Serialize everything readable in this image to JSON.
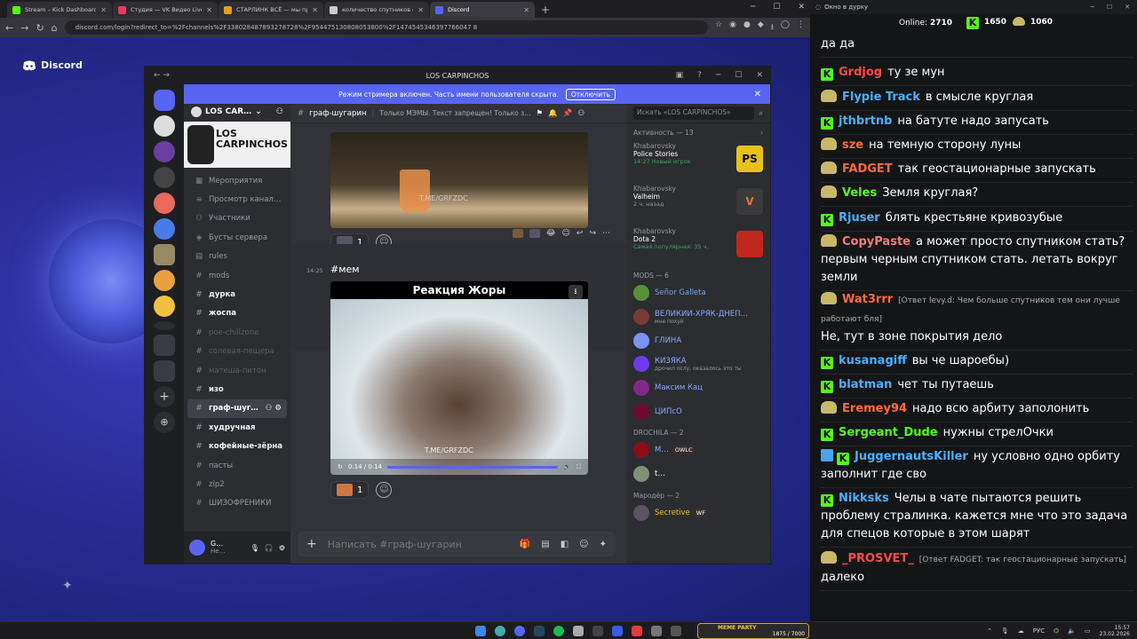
{
  "browser": {
    "tabs": [
      {
        "title": "Stream – Kick Dashboard",
        "color": "#53fc18"
      },
      {
        "title": "Студия — VK Видео Live",
        "color": "#e63a5a"
      },
      {
        "title": "СТАРЛИНК ВСЁ — мы проигр…",
        "color": "#e0a020"
      },
      {
        "title": "количество спутников старл…",
        "color": "#cccccc"
      },
      {
        "title": "Discord",
        "color": "#5865f2"
      }
    ],
    "url": "discord.com/login?redirect_to=%2Fchannels%2F338028487893278728%2F954475130808053800%2F1474545346397766047 8"
  },
  "page": {
    "logo": "Discord"
  },
  "discord": {
    "window_title": "LOS CARPINCHOS",
    "banner_text": "Режим стримера включен. Часть имени пользователя скрыта.",
    "banner_button": "Отключить",
    "server_name": "LOS CAR…",
    "server_banner": "LOS CARPINCHOS",
    "channels": [
      {
        "name": "Мероприятия",
        "icon": "calendar-icon",
        "style": "normal"
      },
      {
        "name": "Просмотр канал…",
        "icon": "browse-icon",
        "style": "normal"
      },
      {
        "name": "Участники",
        "icon": "members-icon",
        "style": "normal"
      },
      {
        "name": "Бусты сервера",
        "icon": "boost-icon",
        "style": "normal"
      },
      {
        "name": "rules",
        "icon": "rules-icon",
        "style": "normal"
      },
      {
        "name": "mods",
        "icon": "#",
        "style": "normal"
      },
      {
        "name": "дурка",
        "icon": "#",
        "style": "bold"
      },
      {
        "name": "жоспа",
        "icon": "#",
        "style": "bold"
      },
      {
        "name": "poe-chillzone",
        "icon": "#",
        "style": "muted"
      },
      {
        "name": "солевая-пещера",
        "icon": "#",
        "style": "muted"
      },
      {
        "name": "матеша-питон",
        "icon": "#",
        "style": "muted"
      },
      {
        "name": "изо",
        "icon": "#",
        "style": "bold"
      },
      {
        "name": "граф-шуг…",
        "icon": "#",
        "style": "selected"
      },
      {
        "name": "худручная",
        "icon": "#",
        "style": "bold"
      },
      {
        "name": "кофейные-зёрна",
        "icon": "#",
        "style": "bold"
      },
      {
        "name": "пасты",
        "icon": "#",
        "style": "normal"
      },
      {
        "name": "zip2",
        "icon": "#",
        "style": "normal"
      },
      {
        "name": "ШИЗОФРЕНИКИ",
        "icon": "#",
        "style": "normal"
      }
    ],
    "user": {
      "name": "G…",
      "status": "Не…"
    },
    "channel_name": "граф-шугарин",
    "channel_topic": "Только МЭМЫ. Текст запрещен! Только з…",
    "search_placeholder": "Искать «LOS CARPINCHOS»",
    "image1_watermark": "T.ME/GRFZDC",
    "reaction1_count": "1",
    "message_time": "14:25",
    "message_text": "#мем",
    "video_title": "Реакция Жоры",
    "video_watermark": "T.ME/GRFZDC",
    "video_time": "0:14 / 0:14",
    "video_progress": 1.0,
    "reaction2_count": "1",
    "composer_placeholder": "Написать #граф-шугарин",
    "activity_header": "Активность — 13",
    "activities": [
      {
        "user": "Khabarovsky",
        "game": "Police Stories",
        "time": "14:27",
        "extra": "Новый игрок",
        "color": "#e8c21a",
        "label": "PS"
      },
      {
        "user": "Khabarovsky",
        "game": "Valheim",
        "time": "2 ч. назад",
        "extra": "",
        "color": "#3a3a3a",
        "label": "V"
      },
      {
        "user": "Khabarovsky",
        "game": "Dota 2",
        "time": "Самая популярная: 35 ч.",
        "extra": "",
        "color": "#c0271e",
        "label": ""
      }
    ],
    "mods_header": "MODS — 6",
    "mods": [
      {
        "name": "Señor Galleta",
        "sub": "",
        "color": "#78a8e8"
      },
      {
        "name": "ВЕЛИКИЙ-ХРЯК-ДНЕП…",
        "sub": "мне похуй",
        "color": "#8ca8ff"
      },
      {
        "name": "ГЛИНА",
        "sub": "",
        "color": "#8ca8ff"
      },
      {
        "name": "КИЗЯКА",
        "sub": "дрочил ослу, оказалось это ты",
        "color": "#8ca8ff"
      },
      {
        "name": "Максим Кац",
        "sub": "",
        "color": "#8ca8ff"
      },
      {
        "name": "ЦИПсО",
        "sub": "",
        "color": "#8ca8ff"
      }
    ],
    "drochila_header": "DROCHILA — 2",
    "drochila": [
      {
        "name": "M…",
        "tag": "OWLC",
        "color": "#8ca8ff"
      },
      {
        "name": "t…",
        "tag": "",
        "color": "#ffffff"
      }
    ],
    "marauder_header": "Мародёр — 2",
    "marauders": [
      {
        "name": "Secretive",
        "tag": "WF",
        "color": "#e8c21a"
      }
    ]
  },
  "chat": {
    "window_title": "Окно в дурку",
    "online_label": "Online:",
    "online": "2710",
    "kick_count": "1650",
    "other_count": "1060",
    "messages": [
      {
        "user": "",
        "reply": "",
        "text": "да да",
        "badge": "none",
        "color": "#ffffff"
      },
      {
        "user": "Grdjog",
        "reply": "",
        "text": "ту зе мун",
        "badge": "kick",
        "color": "#ff4a4a"
      },
      {
        "user": "Flypie Track",
        "reply": "",
        "text": "в смысле круглая",
        "badge": "hat",
        "color": "#4ab0ff"
      },
      {
        "user": "jthbrtnb",
        "reply": "",
        "text": "на батуте надо запусать",
        "badge": "kick",
        "color": "#4ab0ff"
      },
      {
        "user": "sze",
        "reply": "",
        "text": "на темную сторону луны",
        "badge": "hat",
        "color": "#ff6a3a"
      },
      {
        "user": "FADGET",
        "reply": "",
        "text": "так геостационарные запускать",
        "badge": "hat",
        "color": "#ff6a3a"
      },
      {
        "user": "Veles",
        "reply": "",
        "text": "Земля круглая?",
        "badge": "hat",
        "color": "#53fc18"
      },
      {
        "user": "Rjuser",
        "reply": "",
        "text": "блять крестьяне кривозубые",
        "badge": "kick",
        "color": "#4ab0ff"
      },
      {
        "user": "CopyPaste",
        "reply": "",
        "text": "а может просто спутником стать? первым черным спутником стать. летать вокруг земли",
        "badge": "hat",
        "color": "#ff7a7a"
      },
      {
        "user": "Wat3rrr",
        "reply": "[Ответ levy.d: Чем больше спутников тем они лучше работают бля]",
        "text": "Не, тут в зоне покрытия дело",
        "badge": "hat",
        "color": "#ff6a3a"
      },
      {
        "user": "kusanagiff",
        "reply": "",
        "text": "вы че шароебы)",
        "badge": "kick",
        "color": "#4ab0ff"
      },
      {
        "user": "blatman",
        "reply": "",
        "text": "чет ты путаешь",
        "badge": "kick",
        "color": "#4ab0ff"
      },
      {
        "user": "Eremey94",
        "reply": "",
        "text": "надо всю арбиту заполонить",
        "badge": "hat",
        "color": "#ff6a3a"
      },
      {
        "user": "Sergeant_Dude",
        "reply": "",
        "text": "нужны стрелОчки",
        "badge": "kick",
        "color": "#53fc18"
      },
      {
        "user": "JuggernautsKiller",
        "reply": "",
        "text": "ну условно одно орбиту заполнит где сво",
        "badge": "sword",
        "color": "#4ab0ff"
      },
      {
        "user": "Nikksks",
        "reply": "",
        "text": "Челы в чате пытаются решить проблему стралинка. кажется мне что это задача для спецов которые в этом шарят",
        "badge": "kick",
        "color": "#4ab0ff"
      },
      {
        "user": "_PROSVET_",
        "reply": "[Ответ FADGET: так геостационарные запускать]",
        "text": "далеко",
        "badge": "hat",
        "color": "#ff4a4a"
      }
    ]
  },
  "taskbar": {
    "meme_label": "MEME PARTY",
    "meme_value": "1875 / 7000",
    "lang": "РУС",
    "time": "15:57",
    "date": "23.02.2026"
  }
}
